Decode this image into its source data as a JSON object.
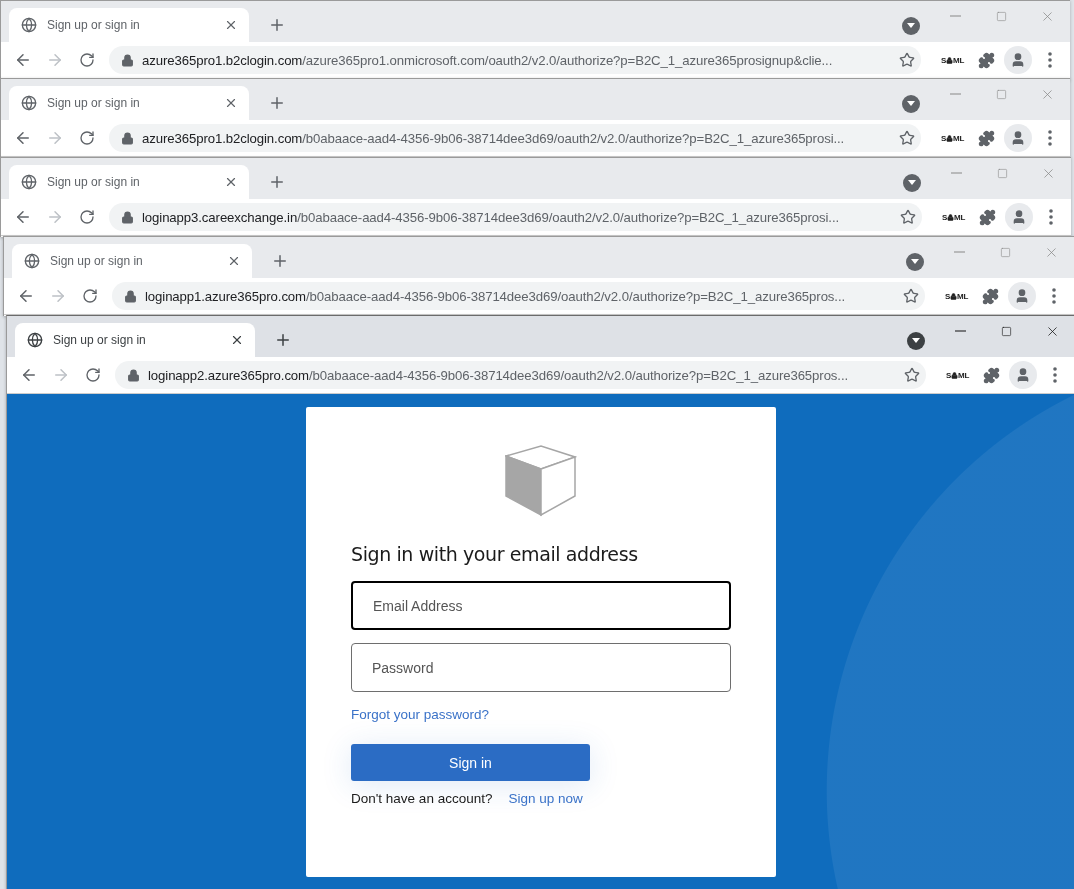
{
  "windows": [
    {
      "focused": false,
      "tab": {
        "title": "Sign up or sign in",
        "selected": true
      },
      "address": {
        "host": "azure365pro1.b2clogin.com",
        "path": "/azure365pro1.onmicrosoft.com/oauth2/v2.0/authorize?p=B2C_1_azure365prosignup&clie..."
      },
      "extension": {
        "before": "S",
        "after": "ML"
      }
    },
    {
      "focused": false,
      "tab": {
        "title": "Sign up or sign in",
        "selected": true
      },
      "address": {
        "host": "azure365pro1.b2clogin.com",
        "path": "/b0abaace-aad4-4356-9b06-38714dee3d69/oauth2/v2.0/authorize?p=B2C_1_azure365prosi..."
      },
      "extension": {
        "before": "S",
        "after": "ML"
      }
    },
    {
      "focused": false,
      "tab": {
        "title": "Sign up or sign in",
        "selected": true
      },
      "address": {
        "host": "loginapp3.careexchange.in",
        "path": "/b0abaace-aad4-4356-9b06-38714dee3d69/oauth2/v2.0/authorize?p=B2C_1_azure365prosi..."
      },
      "extension": {
        "before": "S",
        "after": "ML"
      }
    },
    {
      "focused": false,
      "tab": {
        "title": "Sign up or sign in",
        "selected": true
      },
      "address": {
        "host": "loginapp1.azure365pro.com",
        "path": "/b0abaace-aad4-4356-9b06-38714dee3d69/oauth2/v2.0/authorize?p=B2C_1_azure365pros..."
      },
      "extension": {
        "before": "S",
        "after": "ML"
      }
    },
    {
      "focused": true,
      "tab": {
        "title": "Sign up or sign in",
        "selected": true
      },
      "address": {
        "host": "loginapp2.azure365pro.com",
        "path": "/b0abaace-aad4-4356-9b06-38714dee3d69/oauth2/v2.0/authorize?p=B2C_1_azure365pros..."
      },
      "extension": {
        "before": "S",
        "after": "ML"
      }
    }
  ],
  "signin": {
    "heading": "Sign in with your email address",
    "fields": [
      {
        "placeholder": "Email Address",
        "focused": true
      },
      {
        "placeholder": "Password",
        "focused": false
      }
    ],
    "forgot_link": "Forgot your password?",
    "submit": "Sign in",
    "signup_prompt": "Don't have an account?",
    "signup_link": "Sign up now"
  }
}
